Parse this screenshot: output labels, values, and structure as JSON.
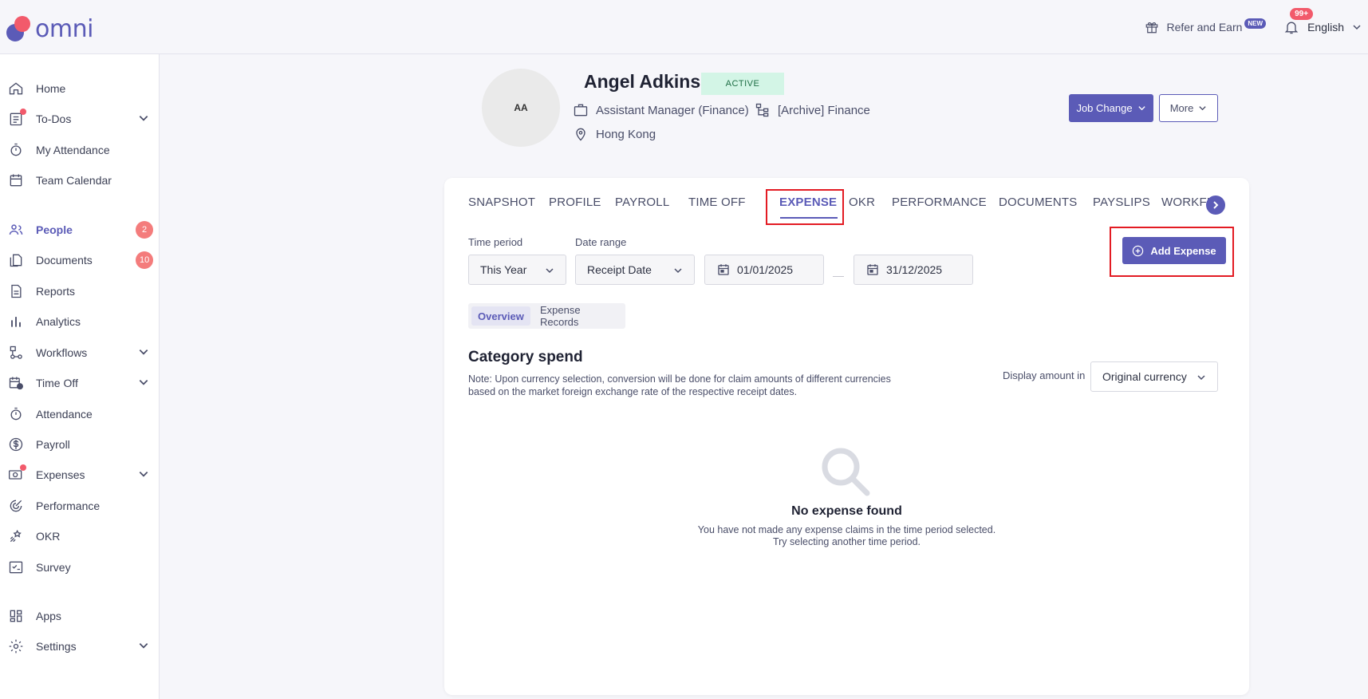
{
  "app": {
    "brand": "omni",
    "accent": "#5b5bb7",
    "danger": "#f25a6b"
  },
  "topbar": {
    "refer_label": "Refer and Earn",
    "refer_badge": "NEW",
    "notif_badge": "99+",
    "language": "English"
  },
  "sidebar": {
    "items": [
      {
        "label": "Home",
        "icon": "home-icon"
      },
      {
        "label": "To-Dos",
        "icon": "todo-icon",
        "chevron": true,
        "dot": true
      },
      {
        "label": "My Attendance",
        "icon": "stopwatch-icon"
      },
      {
        "label": "Team Calendar",
        "icon": "calendar-icon"
      },
      {
        "label": "People",
        "icon": "people-icon",
        "active": true,
        "count": "2"
      },
      {
        "label": "Documents",
        "icon": "documents-icon",
        "count": "10"
      },
      {
        "label": "Reports",
        "icon": "report-icon"
      },
      {
        "label": "Analytics",
        "icon": "analytics-icon"
      },
      {
        "label": "Workflows",
        "icon": "workflow-icon",
        "chevron": true
      },
      {
        "label": "Time Off",
        "icon": "time-off-icon",
        "chevron": true
      },
      {
        "label": "Attendance",
        "icon": "stopwatch-icon"
      },
      {
        "label": "Payroll",
        "icon": "dollar-icon"
      },
      {
        "label": "Expenses",
        "icon": "expenses-icon",
        "chevron": true,
        "dot": true
      },
      {
        "label": "Performance",
        "icon": "performance-icon"
      },
      {
        "label": "OKR",
        "icon": "okr-icon"
      },
      {
        "label": "Survey",
        "icon": "survey-icon"
      },
      {
        "label": "Apps",
        "icon": "apps-icon"
      },
      {
        "label": "Settings",
        "icon": "gear-icon",
        "chevron": true
      }
    ]
  },
  "profile": {
    "initials": "AA",
    "name": "Angel Adkins",
    "status": "ACTIVE",
    "position": "Assistant Manager (Finance)",
    "department": "[Archive] Finance",
    "location": "Hong Kong",
    "job_change_label": "Job Change",
    "more_label": "More"
  },
  "tabs": [
    {
      "label": "SNAPSHOT"
    },
    {
      "label": "PROFILE"
    },
    {
      "label": "PAYROLL"
    },
    {
      "label": "TIME OFF"
    },
    {
      "label": "EXPENSE",
      "active": true
    },
    {
      "label": "OKR"
    },
    {
      "label": "PERFORMANCE"
    },
    {
      "label": "DOCUMENTS"
    },
    {
      "label": "PAYSLIPS"
    },
    {
      "label": "WORKFLOWS"
    }
  ],
  "filters": {
    "time_period_label": "Time period",
    "time_period_value": "This Year",
    "date_range_label": "Date range",
    "date_range_value": "Receipt Date",
    "start_date": "01/01/2025",
    "date_separator": "—",
    "end_date": "31/12/2025"
  },
  "add_expense_label": "Add Expense",
  "subtabs": {
    "overview": "Overview",
    "records": "Expense Records"
  },
  "category": {
    "title": "Category spend",
    "note_line1": "Note: Upon currency selection, conversion will be done for claim amounts of different currencies",
    "note_line2": "based on the market foreign exchange rate of the respective receipt dates.",
    "display_label": "Display amount in",
    "currency_value": "Original currency"
  },
  "empty": {
    "title": "No expense found",
    "line1": "You have not made any expense claims in the time period selected.",
    "line2": "Try selecting another time period."
  }
}
